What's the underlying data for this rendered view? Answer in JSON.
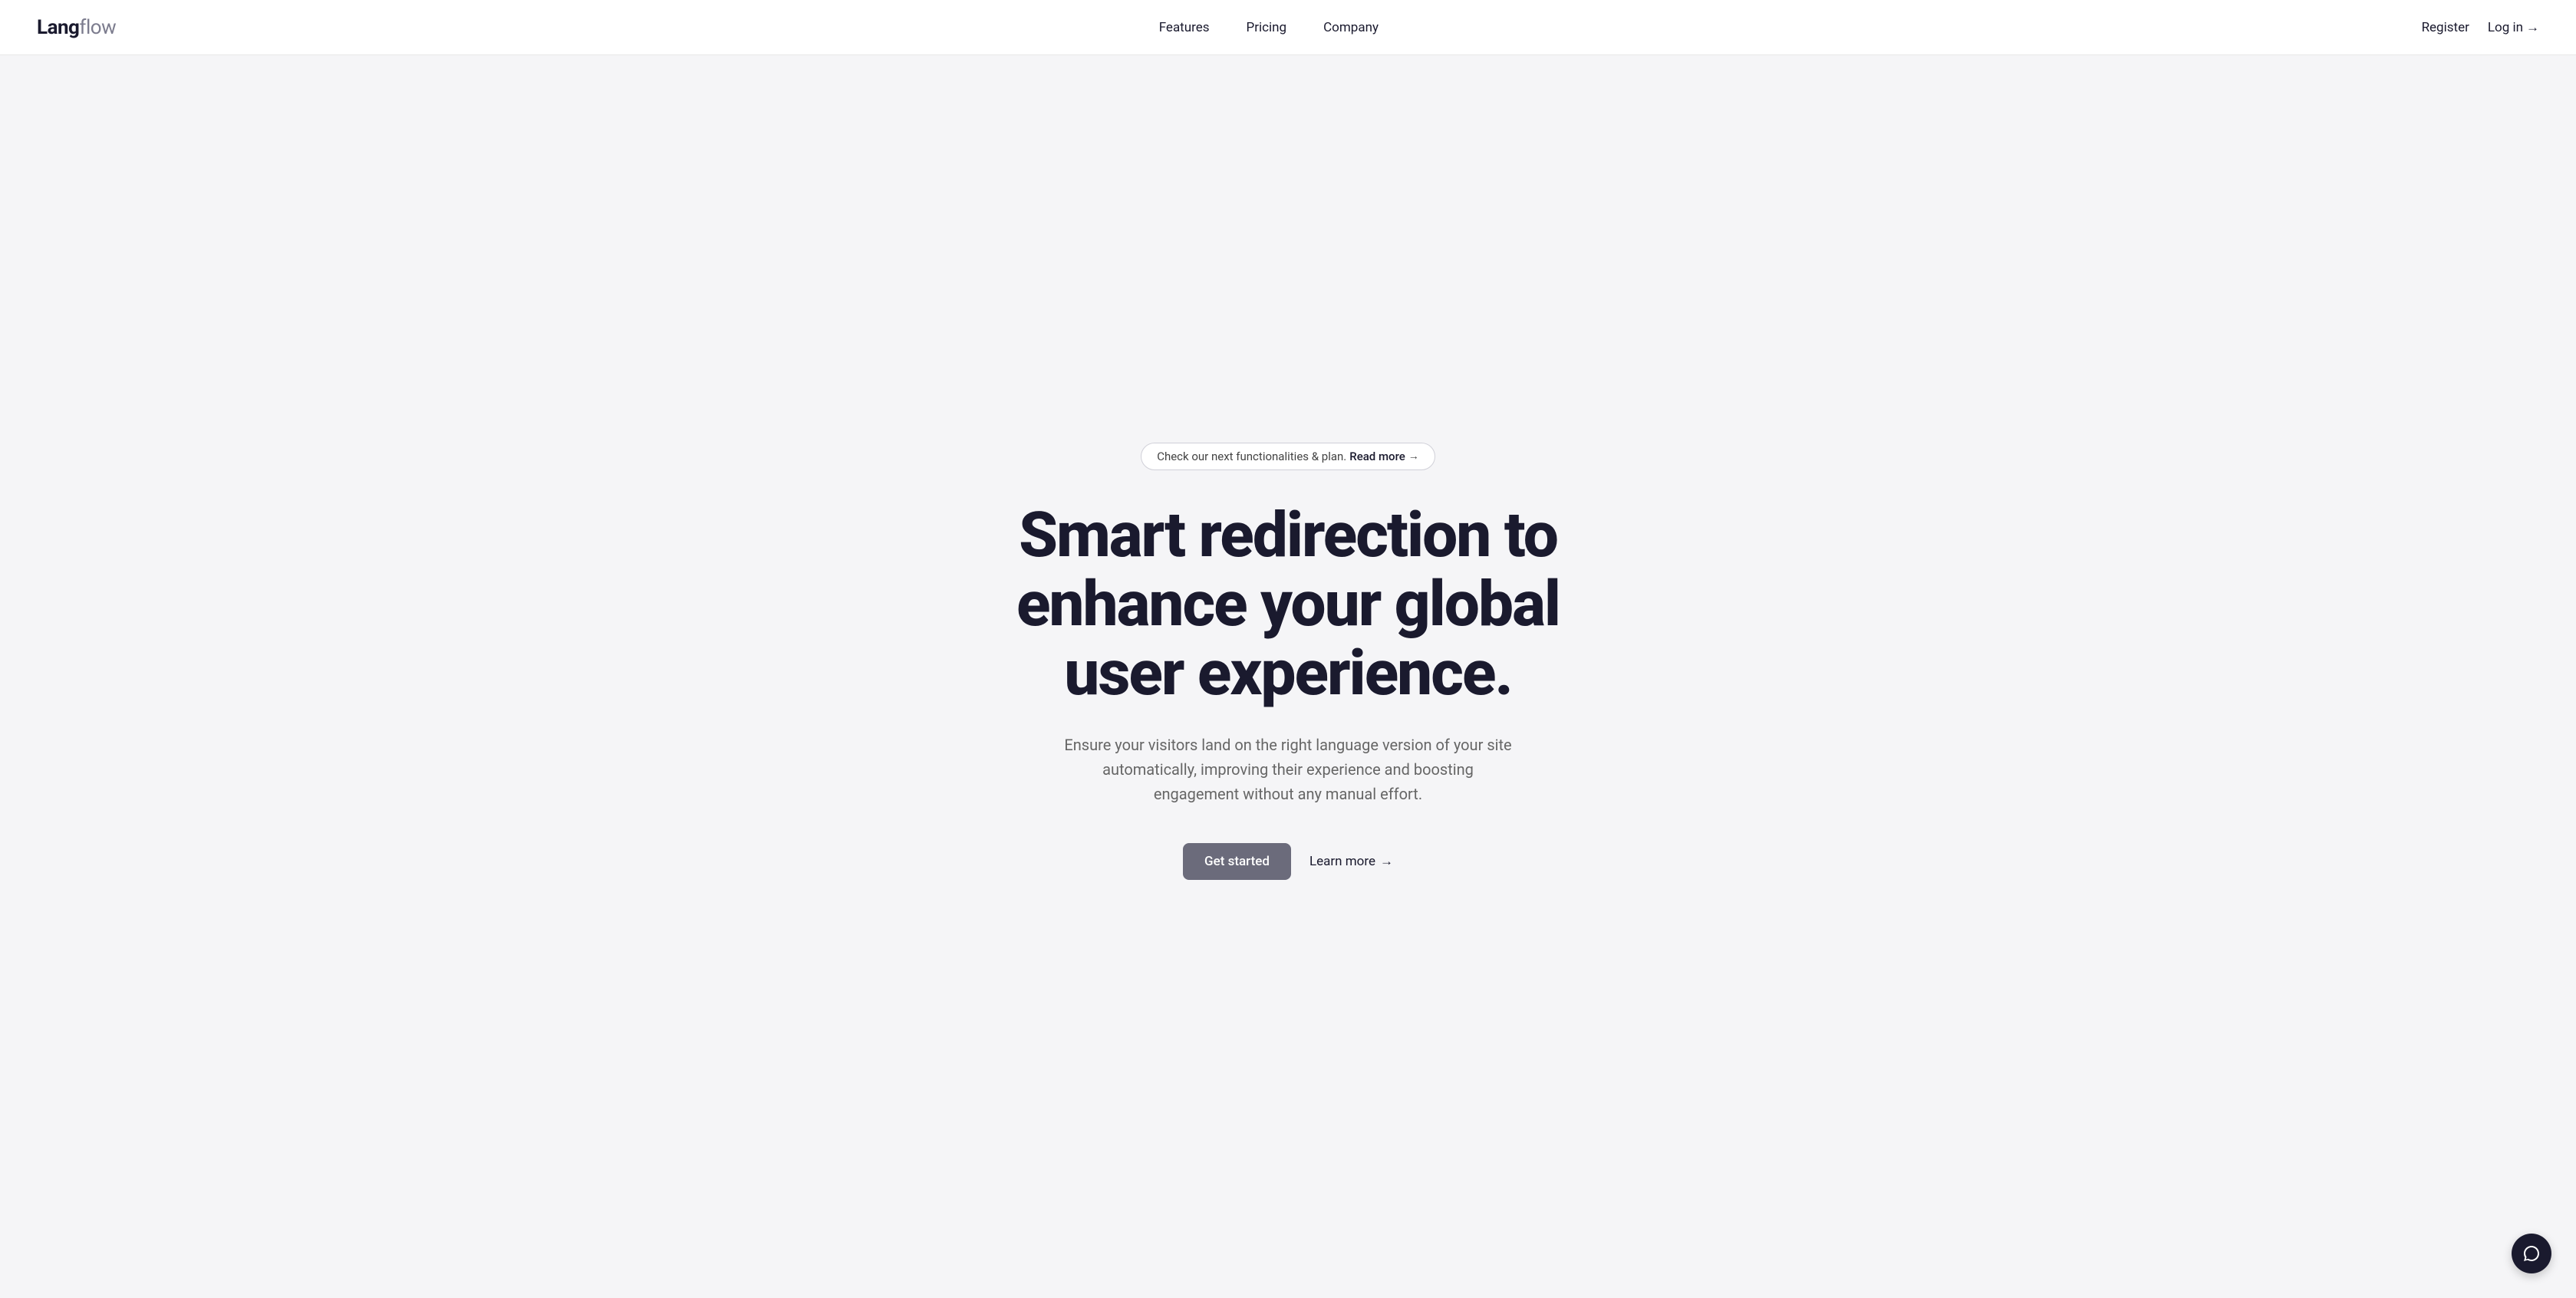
{
  "navbar": {
    "logo_lang": "Lang",
    "logo_flow": "flow",
    "nav_features": "Features",
    "nav_pricing": "Pricing",
    "nav_company": "Company",
    "nav_register": "Register",
    "nav_login": "Log in",
    "nav_login_arrow": "→"
  },
  "hero": {
    "badge_text": "Check our next functionalities & plan.",
    "badge_read_more": "Read more",
    "badge_arrow": "→",
    "title_line1": "Smart redirection to",
    "title_line2": "enhance your global",
    "title_line3": "user experience.",
    "subtitle": "Ensure your visitors land on the right language version of your site automatically, improving their experience and boosting engagement without any manual effort.",
    "cta_primary": "Get started",
    "cta_learn_more": "Learn more",
    "cta_arrow": "→"
  },
  "chat": {
    "label": "Chat support"
  }
}
